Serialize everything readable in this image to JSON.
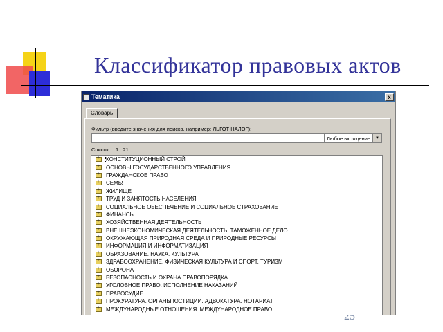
{
  "slide": {
    "title": "Классификатор правовых актов",
    "page_number": "25"
  },
  "window": {
    "title": "Тематика",
    "close_glyph": "x",
    "tabs": [
      {
        "label": "Словарь"
      }
    ],
    "filter": {
      "label": "Фильтр (введите значения для поиска, например: ЛЬГОТ НАЛОГ):",
      "value": "",
      "placeholder": ""
    },
    "mode_select": {
      "selected": "Любое вхождение"
    },
    "count": {
      "label": "Список:",
      "value": "1 : 21"
    },
    "list": [
      {
        "label": "КОНСТИТУЦИОННЫЙ СТРОЙ"
      },
      {
        "label": "ОСНОВЫ ГОСУДАРСТВЕННОГО УПРАВЛЕНИЯ"
      },
      {
        "label": "ГРАЖДАНСКОЕ ПРАВО"
      },
      {
        "label": "СЕМЬЯ"
      },
      {
        "label": "ЖИЛИЩЕ"
      },
      {
        "label": "ТРУД И ЗАНЯТОСТЬ НАСЕЛЕНИЯ"
      },
      {
        "label": "СОЦИАЛЬНОЕ ОБЕСПЕЧЕНИЕ И СОЦИАЛЬНОЕ СТРАХОВАНИЕ"
      },
      {
        "label": "ФИНАНСЫ"
      },
      {
        "label": "ХОЗЯЙСТВЕННАЯ ДЕЯТЕЛЬНОСТЬ"
      },
      {
        "label": "ВНЕШНЕЭКОНОМИЧЕСКАЯ ДЕЯТЕЛЬНОСТЬ. ТАМОЖЕННОЕ ДЕЛО"
      },
      {
        "label": "ОКРУЖАЮЩАЯ ПРИРОДНАЯ СРЕДА И ПРИРОДНЫЕ РЕСУРСЫ"
      },
      {
        "label": "ИНФОРМАЦИЯ И ИНФОРМАТИЗАЦИЯ"
      },
      {
        "label": "ОБРАЗОВАНИЕ. НАУКА. КУЛЬТУРА"
      },
      {
        "label": "ЗДРАВООХРАНЕНИЕ. ФИЗИЧЕСКАЯ КУЛЬТУРА И СПОРТ. ТУРИЗМ"
      },
      {
        "label": "ОБОРОНА"
      },
      {
        "label": "БЕЗОПАСНОСТЬ И ОХРАНА ПРАВОПОРЯДКА"
      },
      {
        "label": "УГОЛОВНОЕ ПРАВО. ИСПОЛНЕНИЕ НАКАЗАНИЙ"
      },
      {
        "label": "ПРАВОСУДИЕ"
      },
      {
        "label": "ПРОКУРАТУРА. ОРГАНЫ ЮСТИЦИИ. АДВОКАТУРА. НОТАРИАТ"
      },
      {
        "label": "МЕЖДУНАРОДНЫЕ ОТНОШЕНИЯ. МЕЖДУНАРОДНОЕ ПРАВО"
      }
    ]
  }
}
